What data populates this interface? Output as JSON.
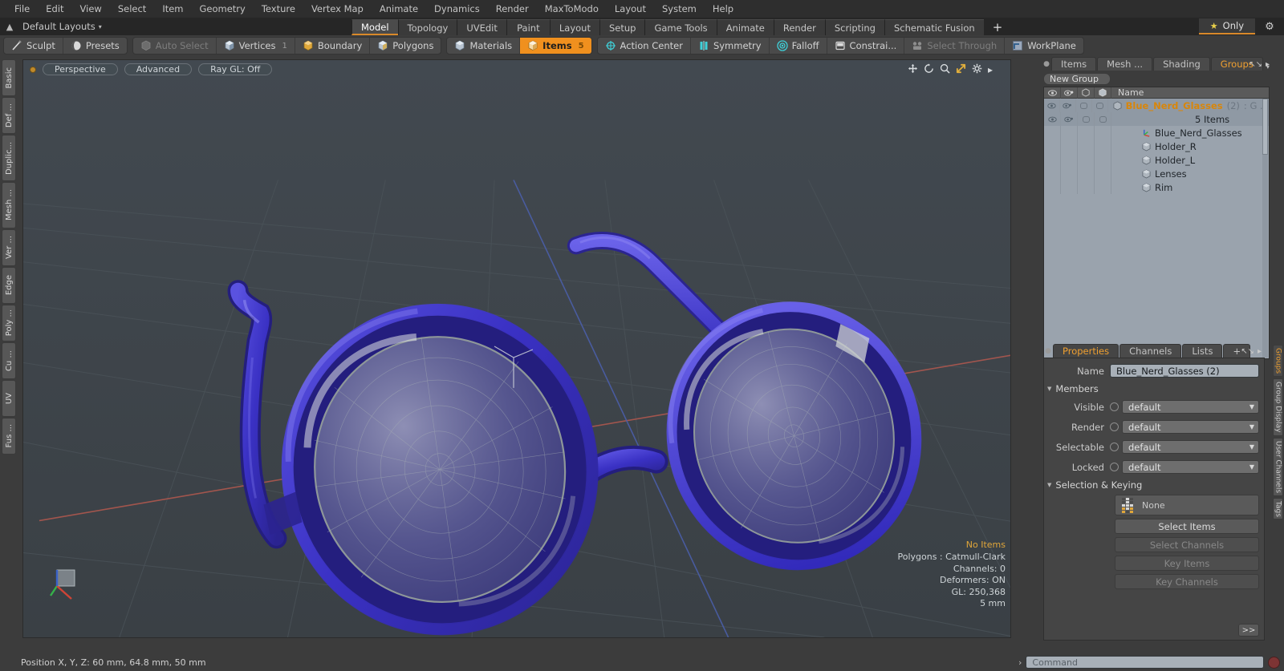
{
  "menubar": {
    "items": [
      "File",
      "Edit",
      "View",
      "Select",
      "Item",
      "Geometry",
      "Texture",
      "Vertex Map",
      "Animate",
      "Dynamics",
      "Render",
      "MaxToModo",
      "Layout",
      "System",
      "Help"
    ]
  },
  "layoutbar": {
    "layout_name": "Default Layouts",
    "caret": "▾",
    "tabs": [
      {
        "label": "Model",
        "active": true
      },
      {
        "label": "Topology",
        "active": false
      },
      {
        "label": "UVEdit",
        "active": false
      },
      {
        "label": "Paint",
        "active": false
      },
      {
        "label": "Layout",
        "active": false
      },
      {
        "label": "Setup",
        "active": false
      },
      {
        "label": "Game Tools",
        "active": false
      },
      {
        "label": "Animate",
        "active": false
      },
      {
        "label": "Render",
        "active": false
      },
      {
        "label": "Scripting",
        "active": false
      },
      {
        "label": "Schematic Fusion",
        "active": false
      }
    ],
    "add_tab_label": "+",
    "only_label": "Only",
    "star_icon": "★",
    "gear_icon": "⚙"
  },
  "modebar": {
    "group_left": [
      {
        "label": "Sculpt",
        "icon": "brush-icon",
        "state": "normal"
      },
      {
        "label": "Presets",
        "icon": "sphere-icon",
        "state": "normal"
      }
    ],
    "group_mid": [
      {
        "label": "Auto Select",
        "icon": "cube-gray-icon",
        "state": "disabled",
        "count": ""
      },
      {
        "label": "Vertices",
        "icon": "cube-blue-icon",
        "state": "normal",
        "count": "1"
      },
      {
        "label": "Boundary",
        "icon": "cube-yellow-icon",
        "state": "normal",
        "count": ""
      },
      {
        "label": "Polygons",
        "icon": "cube-blue-icon",
        "state": "normal",
        "count": ""
      }
    ],
    "group_right": [
      {
        "label": "Materials",
        "icon": "cube-blue-icon",
        "state": "normal",
        "count": ""
      },
      {
        "label": "Items",
        "icon": "cube-orange-icon",
        "state": "selected",
        "count": "5"
      }
    ],
    "group_far": [
      {
        "label": "Action Center",
        "icon": "crosshair-icon",
        "state": "normal"
      },
      {
        "label": "Symmetry",
        "icon": "symmetry-icon",
        "state": "normal"
      },
      {
        "label": "Falloff",
        "icon": "falloff-icon",
        "state": "normal"
      },
      {
        "label": "Constrai...",
        "icon": "constraint-icon",
        "state": "normal"
      },
      {
        "label": "Select Through",
        "icon": "select-through-icon",
        "state": "disabled"
      },
      {
        "label": "WorkPlane",
        "icon": "workplane-icon",
        "state": "normal"
      }
    ]
  },
  "left_tool_tabs": [
    "Basic",
    "Def ...",
    "Duplic...",
    "Mesh ...",
    "Ver ...",
    "Edge",
    "Poly ...",
    "Cu ...",
    "UV",
    "Fus ..."
  ],
  "viewport": {
    "view_mode": "Perspective",
    "shading": "Advanced",
    "raygl": "Ray GL: Off",
    "icons": [
      "move-icon",
      "rotate-icon",
      "zoom-icon",
      "fit-icon",
      "gear-icon",
      "chevron-right-icon"
    ],
    "stats": {
      "selection": "No Items",
      "polygons": "Polygons : Catmull-Clark",
      "channels": "Channels: 0",
      "deformers": "Deformers: ON",
      "gl": "GL: 250,368",
      "grid": "5 mm"
    }
  },
  "right_panel": {
    "tabs": [
      {
        "label": "Items",
        "active": false
      },
      {
        "label": "Mesh ...",
        "active": false
      },
      {
        "label": "Shading",
        "active": false
      },
      {
        "label": "Groups",
        "active": true
      }
    ],
    "tabs_caret": "▾",
    "new_group_label": "New Group",
    "tree": {
      "columns": [
        "eye-icon",
        "render-icon",
        "cube-outline-icon",
        "cube-solid-icon"
      ],
      "name_header": "Name",
      "group_row": {
        "name": "Blue_Nerd_Glasses",
        "count": "(2)",
        "suffix": ": G ...",
        "icon": "group-cube-icon"
      },
      "sub_row": "5 Items",
      "items": [
        {
          "label": "Blue_Nerd_Glasses",
          "icon": "locator-icon"
        },
        {
          "label": "Holder_R",
          "icon": "mesh-cube-icon"
        },
        {
          "label": "Holder_L",
          "icon": "mesh-cube-icon"
        },
        {
          "label": "Lenses",
          "icon": "mesh-cube-icon"
        },
        {
          "label": "Rim",
          "icon": "mesh-cube-icon"
        }
      ]
    }
  },
  "properties": {
    "tabs": [
      {
        "label": "Properties",
        "active": true
      },
      {
        "label": "Channels",
        "active": false
      },
      {
        "label": "Lists",
        "active": false
      },
      {
        "label": "+",
        "active": false
      }
    ],
    "name_label": "Name",
    "name_value": "Blue_Nerd_Glasses (2)",
    "members_section": "Members",
    "members": [
      {
        "label": "Visible",
        "value": "default"
      },
      {
        "label": "Render",
        "value": "default"
      },
      {
        "label": "Selectable",
        "value": "default"
      },
      {
        "label": "Locked",
        "value": "default"
      }
    ],
    "selection_section": "Selection & Keying",
    "selection_value": "None",
    "buttons": [
      {
        "label": "Select Items",
        "enabled": true
      },
      {
        "label": "Select Channels",
        "enabled": false
      },
      {
        "label": "Key Items",
        "enabled": false
      },
      {
        "label": "Key Channels",
        "enabled": false
      }
    ],
    "more_button": ">>"
  },
  "far_right_tabs": [
    {
      "label": "Groups",
      "active": true
    },
    {
      "label": "Group Display",
      "active": false
    },
    {
      "label": "User Channels",
      "active": false
    },
    {
      "label": "Tags",
      "active": false
    }
  ],
  "statusbar": {
    "position": "Position X, Y, Z:   60 mm, 64.8 mm, 50 mm"
  },
  "commandbar": {
    "arrow": "›",
    "placeholder": "Command",
    "record_icon": "record-icon"
  },
  "colors": {
    "accent_orange": "#f0901e",
    "tab_underline": "#d9892a",
    "glasses_blue": "#3a34b8",
    "viewport_bg": "#3d4449",
    "panel_bg": "#3c3c3c",
    "tree_bg": "#9aa3ad"
  }
}
